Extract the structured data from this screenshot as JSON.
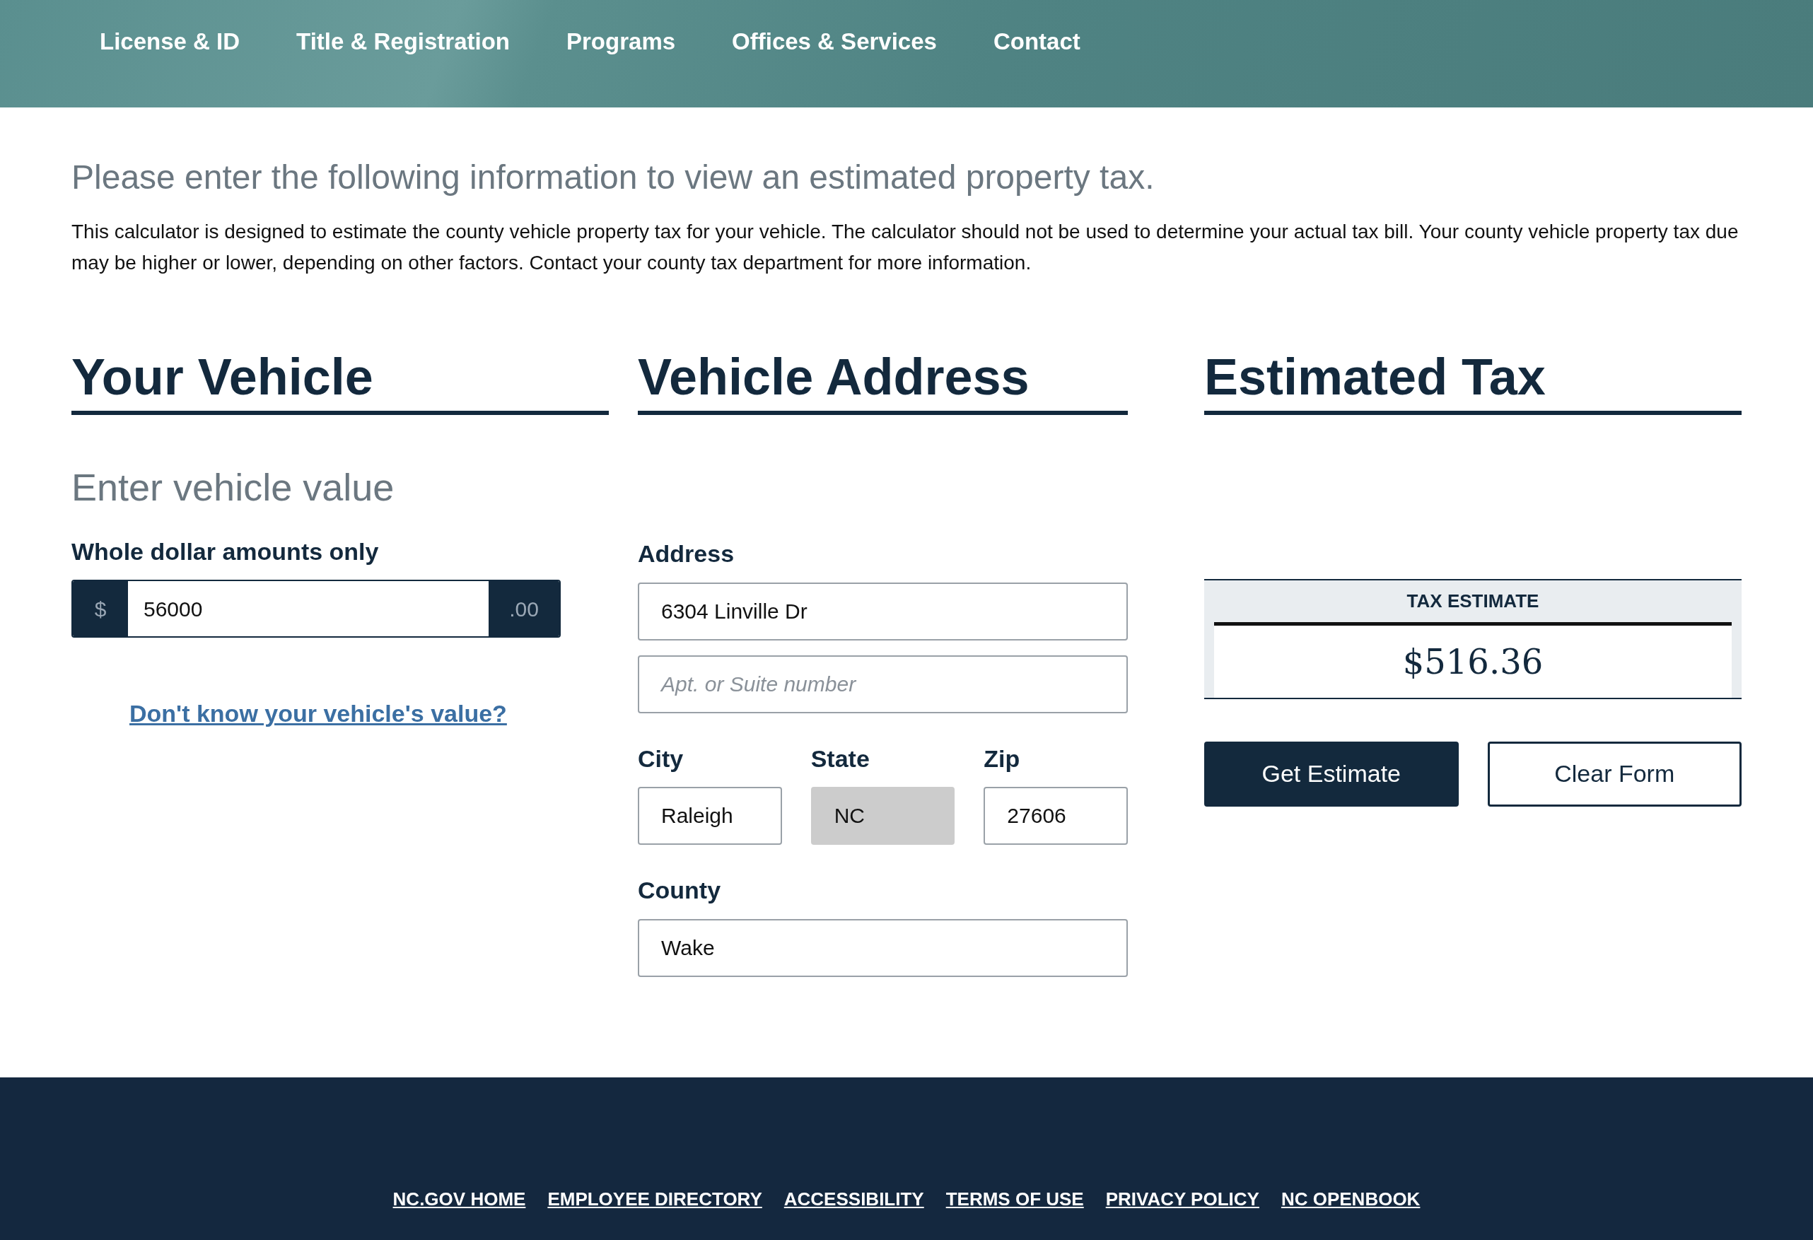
{
  "nav": [
    {
      "label": "License & ID"
    },
    {
      "label": "Title & Registration"
    },
    {
      "label": "Programs"
    },
    {
      "label": "Offices & Services"
    },
    {
      "label": "Contact"
    }
  ],
  "intro": {
    "heading": "Please enter the following information to view an estimated property tax.",
    "text": "This calculator is designed to estimate the county vehicle property tax for your vehicle. The calculator should not be used to determine your actual tax bill. Your county vehicle property tax due may be higher or lower, depending on other factors. Contact your county tax department for more information."
  },
  "vehicle": {
    "heading": "Your Vehicle",
    "subheading": "Enter vehicle value",
    "value_label": "Whole dollar amounts only",
    "prefix": "$",
    "value": "56000",
    "suffix": ".00",
    "help_link": "Don't know your vehicle's value?"
  },
  "address": {
    "heading": "Vehicle Address",
    "street_label": "Address",
    "street": {
      "value": "6304 Linville Dr"
    },
    "unit": {
      "placeholder": "Apt. or Suite number"
    },
    "row": [
      {
        "label": "City",
        "value": "Raleigh",
        "disabled": false
      },
      {
        "label": "State",
        "value": "NC",
        "disabled": true
      },
      {
        "label": "Zip",
        "value": "27606",
        "disabled": false
      }
    ],
    "county_label": "County",
    "county": {
      "value": "Wake"
    }
  },
  "estimate": {
    "heading": "Estimated Tax",
    "label": "TAX ESTIMATE",
    "amount": "$516.36",
    "buttons": [
      {
        "label": "Get Estimate",
        "kind": "primary"
      },
      {
        "label": "Clear Form",
        "kind": "secondary"
      }
    ]
  },
  "footer": {
    "links": [
      "NC.GOV HOME",
      "EMPLOYEE DIRECTORY",
      "ACCESSIBILITY",
      "TERMS OF USE",
      "PRIVACY POLICY",
      "NC OPENBOOK"
    ]
  }
}
